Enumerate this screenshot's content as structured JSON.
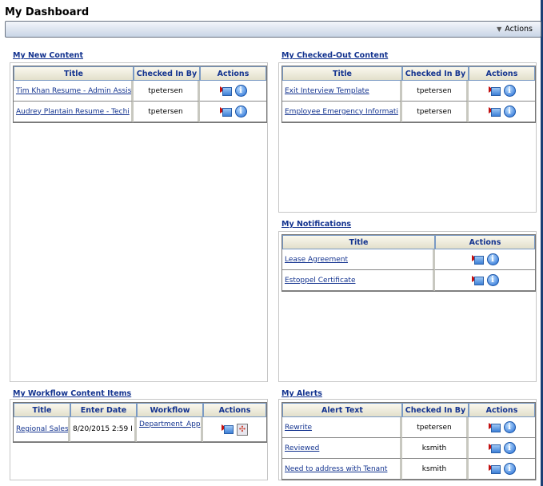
{
  "page_title": "My Dashboard",
  "toolbar": {
    "actions_label": "Actions"
  },
  "new_content": {
    "title": "My New Content",
    "headers": [
      "Title",
      "Checked In By",
      "Actions"
    ],
    "rows": [
      {
        "title": "Tim Khan Resume - Admin Assis",
        "by": "tpetersen"
      },
      {
        "title": "Audrey Plantain Resume - Techi",
        "by": "tpetersen"
      }
    ]
  },
  "checked_out": {
    "title": "My Checked-Out Content",
    "headers": [
      "Title",
      "Checked In By",
      "Actions"
    ],
    "rows": [
      {
        "title": "Exit Interview Template",
        "by": "tpetersen"
      },
      {
        "title": "Employee Emergency Informati",
        "by": "tpetersen"
      }
    ]
  },
  "notifications": {
    "title": "My Notifications",
    "headers": [
      "Title",
      "Actions"
    ],
    "rows": [
      {
        "title": "Lease Agreement"
      },
      {
        "title": "Estoppel Certificate"
      }
    ]
  },
  "workflow": {
    "title": "My Workflow Content Items",
    "headers": [
      "Title",
      "Enter Date",
      "Workflow",
      "Actions"
    ],
    "rows": [
      {
        "title": "Regional Sales",
        "date": "8/20/2015 2:59 I",
        "workflow": "Department_App"
      }
    ]
  },
  "alerts": {
    "title": "My Alerts",
    "headers": [
      "Alert Text",
      "Checked In By",
      "Actions"
    ],
    "rows": [
      {
        "text": "Rewrite",
        "by": "tpetersen"
      },
      {
        "text": "Reviewed",
        "by": "ksmith"
      },
      {
        "text": "Need to address with Tenant",
        "by": "ksmith"
      }
    ]
  }
}
